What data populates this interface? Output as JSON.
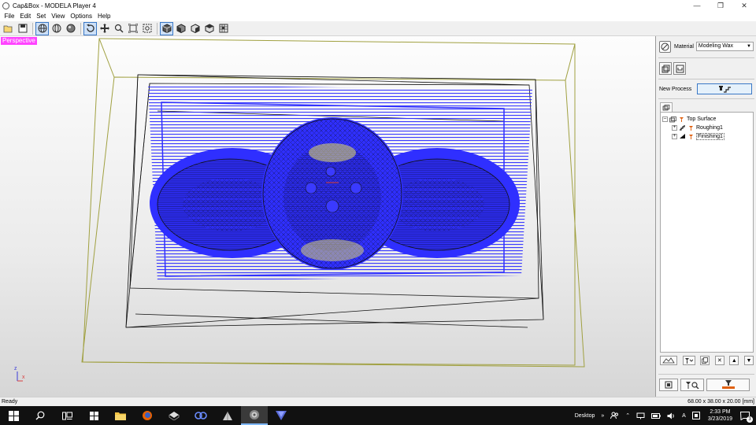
{
  "window": {
    "title": "Cap&Box - MODELA Player 4",
    "controls": [
      "minimize",
      "restore",
      "close"
    ]
  },
  "menu": [
    "File",
    "Edit",
    "Set",
    "View",
    "Options",
    "Help"
  ],
  "toolbar": {
    "groups": [
      [
        "open-icon",
        "save-icon"
      ],
      [
        "wireframe-view-icon",
        "surface-wire-view-icon",
        "shaded-view-icon"
      ],
      [
        "rotate-icon",
        "pan-icon",
        "zoom-icon",
        "zoom-fit-icon",
        "zoom-window-icon"
      ],
      [
        "iso-view-icon",
        "front-view-icon",
        "side-view-icon",
        "top-view-icon",
        "grid-view-icon"
      ]
    ]
  },
  "viewport": {
    "view_label": "Perspective",
    "axis": {
      "z": "z",
      "x": "x"
    }
  },
  "panel": {
    "material_label": "Material",
    "material_value": "Modeling Wax",
    "new_process_label": "New Process",
    "tree": [
      {
        "label": "Top Surface",
        "level": 0
      },
      {
        "label": "Roughing1",
        "level": 1
      },
      {
        "label": "Finishing1",
        "level": 1,
        "selected": true
      }
    ]
  },
  "status": {
    "left": "Ready",
    "right": "68.00 x 38.00 x 20.00 [mm]"
  },
  "taskbar": {
    "desktop_label": "Desktop",
    "time": "2:33 PM",
    "date": "3/23/2019",
    "notification_count": "3"
  },
  "colors": {
    "toolpath": "#2f2fff",
    "stock_box": "#a0a040",
    "view_label_bg": "#ff44ff",
    "accent": "#3a78c6"
  }
}
